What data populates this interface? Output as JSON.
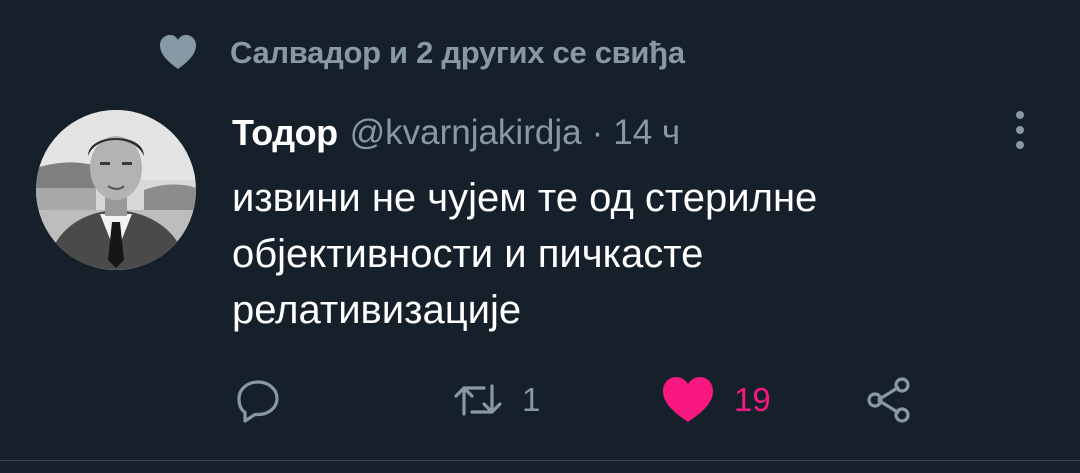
{
  "social_context": {
    "icon": "heart-icon",
    "text": "Салвадор и 2 других се свиђа"
  },
  "tweet": {
    "avatar_icon": "avatar",
    "display_name": "Тодор",
    "handle": "@kvarnjakirdja",
    "separator": "·",
    "timestamp": "14 ч",
    "text_lines": [
      "извини не чујем те од стерилне",
      "објективности и пичкасте",
      "релативизације"
    ],
    "more_icon": "more-vertical-icon"
  },
  "actions": {
    "reply": {
      "icon": "reply-icon",
      "count": ""
    },
    "retweet": {
      "icon": "retweet-icon",
      "count": "1"
    },
    "like": {
      "icon": "heart-filled-icon",
      "count": "19"
    },
    "share": {
      "icon": "share-icon"
    }
  },
  "colors": {
    "background": "#15202b",
    "text_primary": "#ffffff",
    "text_secondary": "#8899a6",
    "like_active": "#f91880",
    "divider": "#38444d"
  }
}
